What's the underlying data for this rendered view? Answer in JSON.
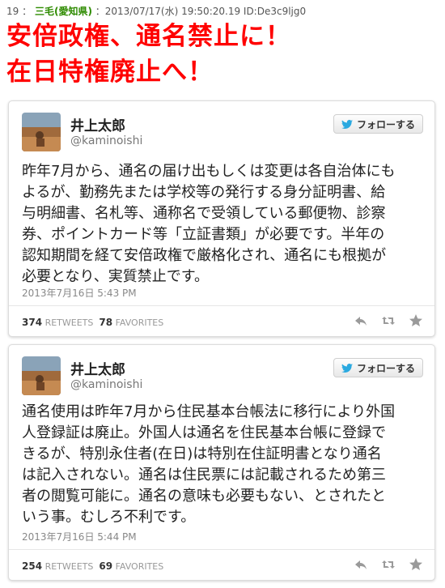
{
  "post": {
    "number": "19",
    "separator": "：",
    "name": "三毛(愛知県)",
    "datetime": "：2013/07/17(水) 19:50:20.19 ID:De3c9ljg0"
  },
  "headline": {
    "line1": "安倍政権、通名禁止に！",
    "line2": "在日特権廃止へ！",
    "color": "#ff0000"
  },
  "tweets": [
    {
      "display_name": "井上太郎",
      "handle": "@kaminoishi",
      "follow_label": "フォローする",
      "text": "昨年7月から、通名の届け出もしくは変更は各自治体にも\nよるが、勤務先または学校等の発行する身分証明書、給\n与明細書、名札等、通称名で受領している郵便物、診察\n券、ポイントカード等「立証書類」が必要です。半年の\n認知期間を経て安倍政権で厳格化され、通名にも根拠が\n必要となり、実質禁止です。",
      "timestamp": "2013年7月16日 5:43 PM",
      "retweets": "374",
      "retweets_label": "RETWEETS",
      "favorites": "78",
      "favorites_label": "FAVORITES"
    },
    {
      "display_name": "井上太郎",
      "handle": "@kaminoishi",
      "follow_label": "フォローする",
      "text": "通名使用は昨年7月から住民基本台帳法に移行により外国\n人登録証は廃止。外国人は通名を住民基本台帳に登録で\nきるが、特別永住者(在日)は特別在住証明書となり通名\nは記入されない。通名は住民票には記載されるため第三\n者の閲覧可能に。通名の意味も必要もない、とされたと\nいう事。むしろ不利です。",
      "timestamp": "2013年7月16日 5:44 PM",
      "retweets": "254",
      "retweets_label": "RETWEETS",
      "favorites": "69",
      "favorites_label": "FAVORITES"
    }
  ],
  "icons": {
    "follow": "twitter-bird-icon",
    "reply": "reply-icon",
    "retweet": "retweet-icon",
    "favorite": "star-icon"
  },
  "colors": {
    "post_name": "#2e8b00",
    "twitter_blue": "#2aa9e0",
    "action_gray": "#9a9a9a"
  }
}
